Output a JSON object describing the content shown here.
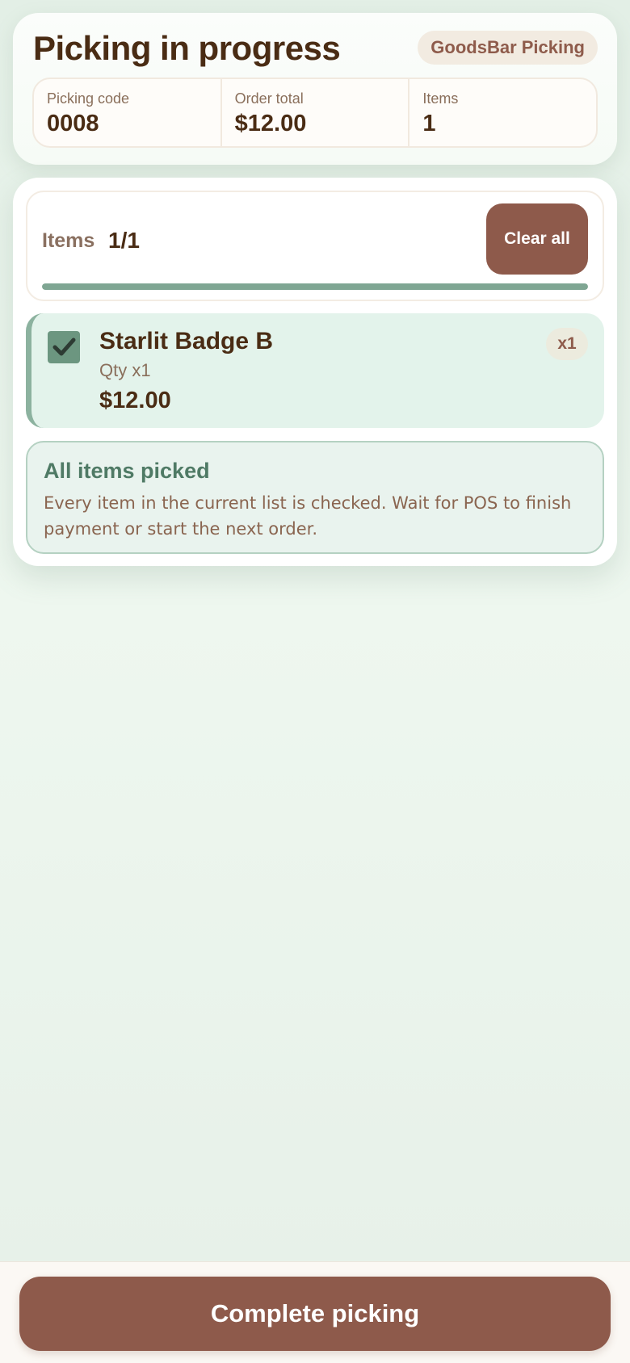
{
  "header": {
    "title": "Picking in progress",
    "brand_badge": "GoodsBar Picking",
    "stats": [
      {
        "label": "Picking code",
        "value": "0008"
      },
      {
        "label": "Order total",
        "value": "$12.00"
      },
      {
        "label": "Items",
        "value": "1"
      }
    ]
  },
  "progress": {
    "label": "Items",
    "count": "1/1",
    "fraction": 1.0,
    "clear_label": "Clear all"
  },
  "items": [
    {
      "name": "Starlit Badge B",
      "qty_text": "Qty x1",
      "price": "$12.00",
      "qty_badge": "x1",
      "checked": true
    }
  ],
  "status": {
    "title": "All items picked",
    "text": "Every item in the current list is checked. Wait for POS to finish payment or start the next order."
  },
  "footer": {
    "complete_label": "Complete picking"
  },
  "colors": {
    "brand_brown": "#8e5a4b",
    "accent_green": "#7fa693",
    "text_dark": "#4a2c14"
  }
}
